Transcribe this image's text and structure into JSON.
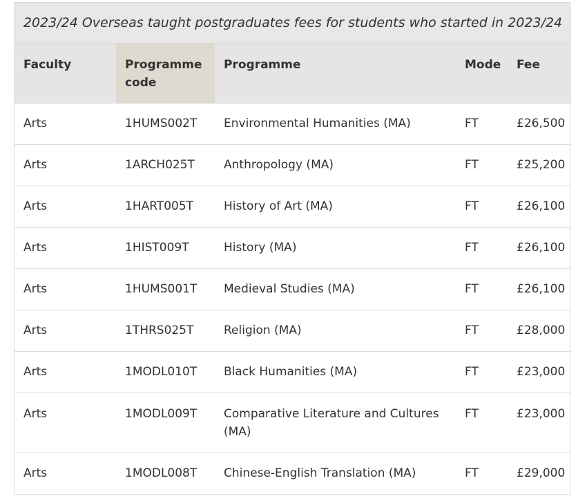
{
  "table": {
    "caption": "2023/24 Overseas taught postgraduates fees for students who started in 2023/24",
    "headers": {
      "faculty": "Faculty",
      "programme_code": "Programme code",
      "programme": "Programme",
      "mode": "Mode",
      "fee": "Fee"
    },
    "rows": [
      {
        "faculty": "Arts",
        "code": "1HUMS002T",
        "programme": "Environmental Humanities (MA)",
        "mode": "FT",
        "fee": "£26,500"
      },
      {
        "faculty": "Arts",
        "code": "1ARCH025T",
        "programme": "Anthropology (MA)",
        "mode": "FT",
        "fee": "£25,200"
      },
      {
        "faculty": "Arts",
        "code": "1HART005T",
        "programme": "History of Art (MA)",
        "mode": "FT",
        "fee": "£26,100"
      },
      {
        "faculty": "Arts",
        "code": "1HIST009T",
        "programme": "History (MA)",
        "mode": "FT",
        "fee": "£26,100"
      },
      {
        "faculty": "Arts",
        "code": "1HUMS001T",
        "programme": "Medieval Studies (MA)",
        "mode": "FT",
        "fee": "£26,100"
      },
      {
        "faculty": "Arts",
        "code": "1THRS025T",
        "programme": "Religion (MA)",
        "mode": "FT",
        "fee": "£28,000"
      },
      {
        "faculty": "Arts",
        "code": "1MODL010T",
        "programme": "Black Humanities (MA)",
        "mode": "FT",
        "fee": "£23,000"
      },
      {
        "faculty": "Arts",
        "code": "1MODL009T",
        "programme": "Comparative Literature and Cultures (MA)",
        "mode": "FT",
        "fee": "£23,000"
      },
      {
        "faculty": "Arts",
        "code": "1MODL008T",
        "programme": "Chinese-English Translation (MA)",
        "mode": "FT",
        "fee": "£29,000"
      }
    ]
  }
}
